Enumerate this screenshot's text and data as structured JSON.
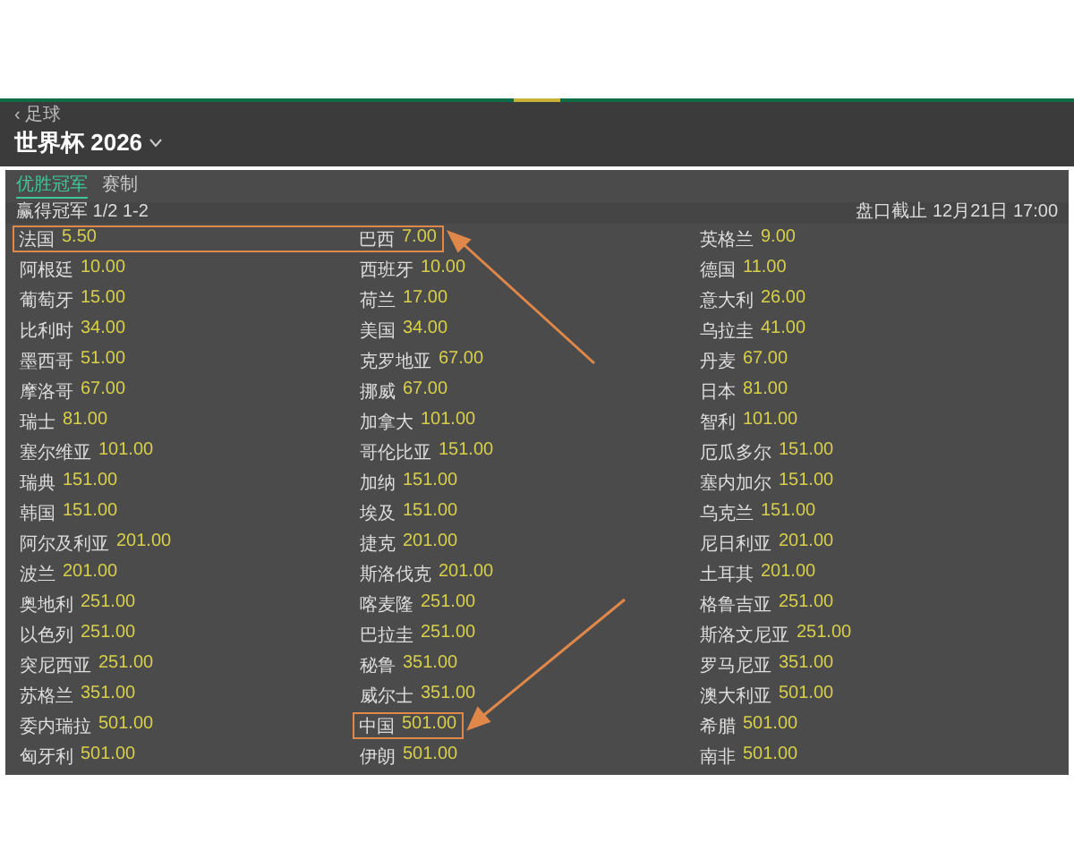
{
  "breadcrumb": "‹ 足球",
  "title": "世界杯 2026",
  "tabs": [
    {
      "label": "优胜冠军",
      "selected": true
    },
    {
      "label": "赛制",
      "selected": false
    }
  ],
  "market": {
    "name": "赢得冠军 1/2 1-2",
    "closing": "盘口截止 12月21日 17:00"
  },
  "rows": [
    {
      "cells": [
        {
          "team": "法国",
          "odds": "5.50",
          "highlighted": true
        },
        {
          "team": "巴西",
          "odds": "7.00",
          "highlighted": true
        },
        {
          "team": "英格兰",
          "odds": "9.00",
          "highlighted": false
        }
      ]
    },
    {
      "cells": [
        {
          "team": "阿根廷",
          "odds": "10.00",
          "highlighted": false
        },
        {
          "team": "西班牙",
          "odds": "10.00",
          "highlighted": false
        },
        {
          "team": "德国",
          "odds": "11.00",
          "highlighted": false
        }
      ]
    },
    {
      "cells": [
        {
          "team": "葡萄牙",
          "odds": "15.00",
          "highlighted": false
        },
        {
          "team": "荷兰",
          "odds": "17.00",
          "highlighted": false
        },
        {
          "team": "意大利",
          "odds": "26.00",
          "highlighted": false
        }
      ]
    },
    {
      "cells": [
        {
          "team": "比利时",
          "odds": "34.00",
          "highlighted": false
        },
        {
          "team": "美国",
          "odds": "34.00",
          "highlighted": false
        },
        {
          "team": "乌拉圭",
          "odds": "41.00",
          "highlighted": false
        }
      ]
    },
    {
      "cells": [
        {
          "team": "墨西哥",
          "odds": "51.00",
          "highlighted": false
        },
        {
          "team": "克罗地亚",
          "odds": "67.00",
          "highlighted": false
        },
        {
          "team": "丹麦",
          "odds": "67.00",
          "highlighted": false
        }
      ]
    },
    {
      "cells": [
        {
          "team": "摩洛哥",
          "odds": "67.00",
          "highlighted": false
        },
        {
          "team": "挪威",
          "odds": "67.00",
          "highlighted": false
        },
        {
          "team": "日本",
          "odds": "81.00",
          "highlighted": false
        }
      ]
    },
    {
      "cells": [
        {
          "team": "瑞士",
          "odds": "81.00",
          "highlighted": false
        },
        {
          "team": "加拿大",
          "odds": "101.00",
          "highlighted": false
        },
        {
          "team": "智利",
          "odds": "101.00",
          "highlighted": false
        }
      ]
    },
    {
      "cells": [
        {
          "team": "塞尔维亚",
          "odds": "101.00",
          "highlighted": false
        },
        {
          "team": "哥伦比亚",
          "odds": "151.00",
          "highlighted": false
        },
        {
          "team": "厄瓜多尔",
          "odds": "151.00",
          "highlighted": false
        }
      ]
    },
    {
      "cells": [
        {
          "team": "瑞典",
          "odds": "151.00",
          "highlighted": false
        },
        {
          "team": "加纳",
          "odds": "151.00",
          "highlighted": false
        },
        {
          "team": "塞内加尔",
          "odds": "151.00",
          "highlighted": false
        }
      ]
    },
    {
      "cells": [
        {
          "team": "韩国",
          "odds": "151.00",
          "highlighted": false
        },
        {
          "team": "埃及",
          "odds": "151.00",
          "highlighted": false
        },
        {
          "team": "乌克兰",
          "odds": "151.00",
          "highlighted": false
        }
      ]
    },
    {
      "cells": [
        {
          "team": "阿尔及利亚",
          "odds": "201.00",
          "highlighted": false
        },
        {
          "team": "捷克",
          "odds": "201.00",
          "highlighted": false
        },
        {
          "team": "尼日利亚",
          "odds": "201.00",
          "highlighted": false
        }
      ]
    },
    {
      "cells": [
        {
          "team": "波兰",
          "odds": "201.00",
          "highlighted": false
        },
        {
          "team": "斯洛伐克",
          "odds": "201.00",
          "highlighted": false
        },
        {
          "team": "土耳其",
          "odds": "201.00",
          "highlighted": false
        }
      ]
    },
    {
      "cells": [
        {
          "team": "奥地利",
          "odds": "251.00",
          "highlighted": false
        },
        {
          "team": "喀麦隆",
          "odds": "251.00",
          "highlighted": false
        },
        {
          "team": "格鲁吉亚",
          "odds": "251.00",
          "highlighted": false
        }
      ]
    },
    {
      "cells": [
        {
          "team": "以色列",
          "odds": "251.00",
          "highlighted": false
        },
        {
          "team": "巴拉圭",
          "odds": "251.00",
          "highlighted": false
        },
        {
          "team": "斯洛文尼亚",
          "odds": "251.00",
          "highlighted": false
        }
      ]
    },
    {
      "cells": [
        {
          "team": "突尼西亚",
          "odds": "251.00",
          "highlighted": false
        },
        {
          "team": "秘鲁",
          "odds": "351.00",
          "highlighted": false
        },
        {
          "team": "罗马尼亚",
          "odds": "351.00",
          "highlighted": false
        }
      ]
    },
    {
      "cells": [
        {
          "team": "苏格兰",
          "odds": "351.00",
          "highlighted": false
        },
        {
          "team": "威尔士",
          "odds": "351.00",
          "highlighted": false
        },
        {
          "team": "澳大利亚",
          "odds": "501.00",
          "highlighted": false
        }
      ]
    },
    {
      "cells": [
        {
          "team": "委内瑞拉",
          "odds": "501.00",
          "highlighted": false
        },
        {
          "team": "中国",
          "odds": "501.00",
          "highlighted": true
        },
        {
          "team": "希腊",
          "odds": "501.00",
          "highlighted": false
        }
      ]
    },
    {
      "cells": [
        {
          "team": "匈牙利",
          "odds": "501.00",
          "highlighted": false
        },
        {
          "team": "伊朗",
          "odds": "501.00",
          "highlighted": false
        },
        {
          "team": "南非",
          "odds": "501.00",
          "highlighted": false
        }
      ]
    }
  ]
}
